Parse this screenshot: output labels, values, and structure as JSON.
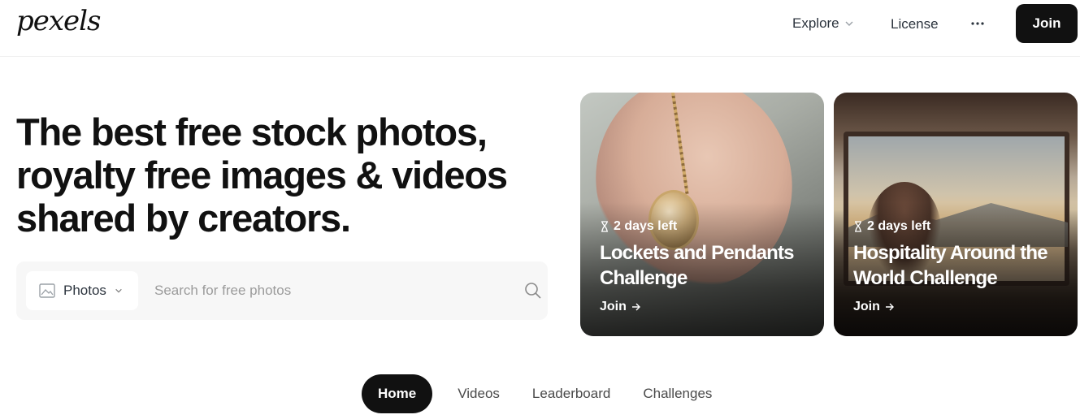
{
  "header": {
    "logo": "pexels",
    "nav": {
      "explore": "Explore",
      "license": "License",
      "more_icon": "more-horizontal-icon",
      "join": "Join"
    }
  },
  "hero": {
    "title_line1": "The best free stock photos,",
    "title_line2": "royalty free images & videos",
    "title_line3": "shared by creators."
  },
  "search": {
    "type_label": "Photos",
    "type_icon": "image-icon",
    "placeholder": "Search for free photos",
    "button_icon": "search-icon"
  },
  "challenges": [
    {
      "time_left": "2 days left",
      "title": "Lockets and Pendants Challenge",
      "cta": "Join"
    },
    {
      "time_left": "2 days left",
      "title": "Hospitality Around the World Challenge",
      "cta": "Join"
    }
  ],
  "tabs": [
    {
      "label": "Home",
      "active": true
    },
    {
      "label": "Videos",
      "active": false
    },
    {
      "label": "Leaderboard",
      "active": false
    },
    {
      "label": "Challenges",
      "active": false
    }
  ],
  "colors": {
    "primary": "#111111",
    "surface": "#f7f7f7",
    "text_muted": "#9b9b9b",
    "nav_text": "#2c343e"
  }
}
